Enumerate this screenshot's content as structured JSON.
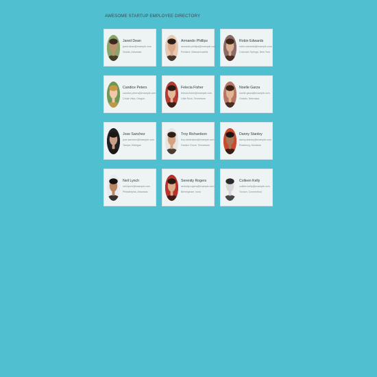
{
  "page": {
    "title": "AWESOME STARTUP EMPLOYEE DIRECTORY"
  },
  "colors": {
    "background": "#50bfd0",
    "card": "#eef3f4"
  },
  "employees": [
    {
      "name": "Jared Dean",
      "email": "jared.dean@example.com",
      "location": "Visalia, Arkansas",
      "skin": "#b9946e",
      "hair": "#3b2a1d",
      "bg": "#8aa56b"
    },
    {
      "name": "Armando Phillips",
      "email": "armando.phillips@example.com",
      "location": "Portland, Massachusetts",
      "skin": "#d9a98a",
      "hair": "#2a1d17",
      "bg": "#e7c8b2"
    },
    {
      "name": "Robin Edwards",
      "email": "robin.edwards@example.com",
      "location": "Colorado Springs, New York",
      "skin": "#d8b197",
      "hair": "#3c2418",
      "bg": "#8a6b66"
    },
    {
      "name": "Candice Peters",
      "email": "candice.peters@example.com",
      "location": "Chula Vista, Oregon",
      "skin": "#f0c9a8",
      "hair": "#c99a43",
      "bg": "#6d9657"
    },
    {
      "name": "Felecia Fisher",
      "email": "felecia.fisher@example.com",
      "location": "Little Rock, Tennessee",
      "skin": "#e4b899",
      "hair": "#2a1a14",
      "bg": "#b33c32"
    },
    {
      "name": "Noelle Garza",
      "email": "noelle.garza@example.com",
      "location": "Ontario, Nebraska",
      "skin": "#e2b493",
      "hair": "#3a2116",
      "bg": "#b57865"
    },
    {
      "name": "Jose Sanchez",
      "email": "jose.sanchez@example.com",
      "location": "Tampa, Michigan",
      "skin": "#c9a088",
      "hair": "#1d1512",
      "bg": "#1f2126"
    },
    {
      "name": "Troy Richardson",
      "email": "troy.richardson@example.com",
      "location": "Garden Grove, Tennessee",
      "skin": "#d4a282",
      "hair": "#2e1e16",
      "bg": "#e8e4e0"
    },
    {
      "name": "Danny Stanley",
      "email": "danny.stanley@example.com",
      "location": "Roseburg, Montana",
      "skin": "#a87658",
      "hair": "#1c1512",
      "bg": "#c94a2f"
    },
    {
      "name": "Neil Lynch",
      "email": "neil.lynch@example.com",
      "location": "Philadelphia, Arkansas",
      "skin": "#b88865",
      "hair": "#151212",
      "bg": "#e9ebee"
    },
    {
      "name": "Serenity Rogers",
      "email": "serenity.rogers@example.com",
      "location": "Birmingham, Iowa",
      "skin": "#dcae8c",
      "hair": "#2a1a14",
      "bg": "#b8332c"
    },
    {
      "name": "Colleen Kelly",
      "email": "colleen.kelly@example.com",
      "location": "Tucson, Connecticut",
      "skin": "#d8d8d8",
      "hair": "#2a2a2a",
      "bg": "#f1f1f1"
    }
  ]
}
